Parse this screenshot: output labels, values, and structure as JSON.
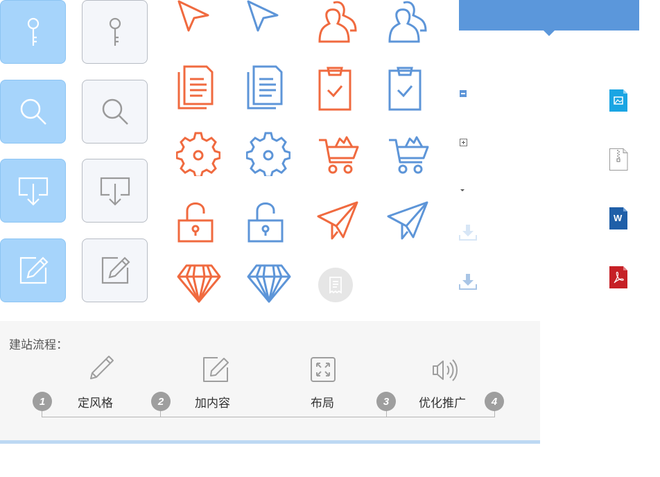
{
  "colors": {
    "orange": "#f06a3f",
    "blue": "#5d95d8",
    "tile_blue_bg": "#a6d4fb",
    "tile_gray_bg": "#f4f6fa",
    "banner": "#5b97db",
    "step_gray": "#9e9e9e"
  },
  "tiles": [
    {
      "icon": "key-icon",
      "style": "blue"
    },
    {
      "icon": "key-icon",
      "style": "gray"
    },
    {
      "icon": "search-icon",
      "style": "blue"
    },
    {
      "icon": "search-icon",
      "style": "gray"
    },
    {
      "icon": "download-tray-icon",
      "style": "blue"
    },
    {
      "icon": "download-tray-icon",
      "style": "gray"
    },
    {
      "icon": "edit-icon",
      "style": "blue"
    },
    {
      "icon": "edit-icon",
      "style": "gray"
    }
  ],
  "icon_grid": [
    "cursor-icon",
    "cursor-icon",
    "users-icon",
    "users-icon",
    "document-icon",
    "document-icon",
    "clipboard-check-icon",
    "clipboard-check-icon",
    "gear-icon",
    "gear-icon",
    "cart-icon",
    "cart-icon",
    "unlock-icon",
    "unlock-icon",
    "paper-plane-icon",
    "paper-plane-icon",
    "diamond-icon",
    "diamond-icon",
    "receipt-icon"
  ],
  "side_icons": [
    "collapse-icon",
    "expand-icon",
    "caret-down-icon",
    "download-light-icon",
    "download-icon"
  ],
  "file_icons": [
    "image-file-icon",
    "zip-file-icon",
    "word-file-icon",
    "pdf-file-icon"
  ],
  "file_labels": {
    "word": "W"
  },
  "flow": {
    "title": "建站流程：",
    "steps": [
      {
        "num": "1",
        "label": "定风格",
        "icon": "pencil-icon"
      },
      {
        "num": "2",
        "label": "加内容",
        "icon": "edit-box-icon"
      },
      {
        "num": "",
        "label": "布局",
        "icon": "expand-arrows-icon"
      },
      {
        "num": "3",
        "label": "优化推广",
        "icon": "speaker-icon"
      },
      {
        "num": "4",
        "label": "",
        "icon": ""
      }
    ]
  }
}
